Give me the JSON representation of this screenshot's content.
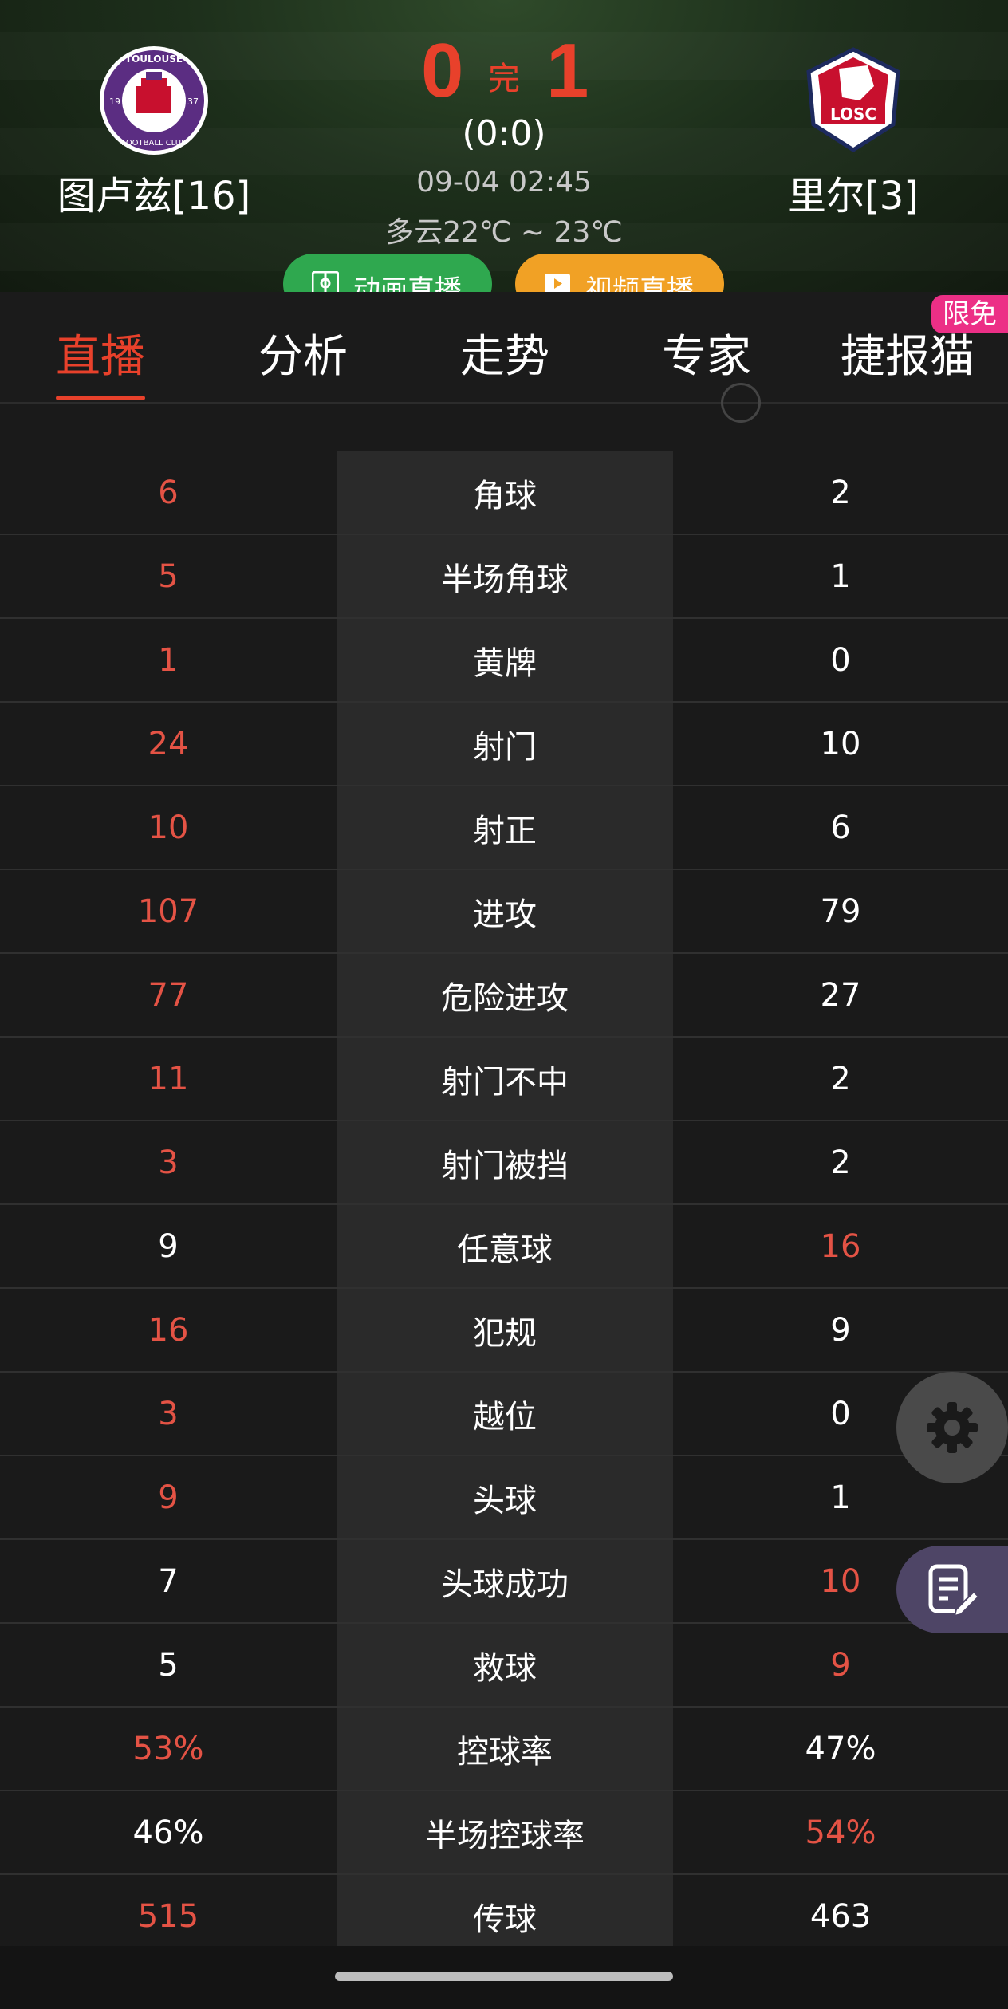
{
  "match": {
    "home_team": "图卢兹[16]",
    "away_team": "里尔[3]",
    "home_score": "0",
    "away_score": "1",
    "status": "完",
    "half_time": "(0:0)",
    "kickoff": "09-04 02:45",
    "weather": "多云22℃ ~ 23℃",
    "home_logo_text": "TOULOUSE FOOTBALL CLUB 19 37",
    "away_logo_text": "LOSC"
  },
  "buttons": {
    "animation": "动画直播",
    "video": "视频直播"
  },
  "tabs": [
    {
      "label": "直播"
    },
    {
      "label": "分析"
    },
    {
      "label": "走势"
    },
    {
      "label": "专家"
    },
    {
      "label": "捷报猫"
    }
  ],
  "badge": "限免",
  "stats": [
    {
      "label": "角球",
      "home": "6",
      "away": "2",
      "leader": "home"
    },
    {
      "label": "半场角球",
      "home": "5",
      "away": "1",
      "leader": "home"
    },
    {
      "label": "黄牌",
      "home": "1",
      "away": "0",
      "leader": "home"
    },
    {
      "label": "射门",
      "home": "24",
      "away": "10",
      "leader": "home"
    },
    {
      "label": "射正",
      "home": "10",
      "away": "6",
      "leader": "home"
    },
    {
      "label": "进攻",
      "home": "107",
      "away": "79",
      "leader": "home"
    },
    {
      "label": "危险进攻",
      "home": "77",
      "away": "27",
      "leader": "home"
    },
    {
      "label": "射门不中",
      "home": "11",
      "away": "2",
      "leader": "home"
    },
    {
      "label": "射门被挡",
      "home": "3",
      "away": "2",
      "leader": "home"
    },
    {
      "label": "任意球",
      "home": "9",
      "away": "16",
      "leader": "away"
    },
    {
      "label": "犯规",
      "home": "16",
      "away": "9",
      "leader": "home"
    },
    {
      "label": "越位",
      "home": "3",
      "away": "0",
      "leader": "home"
    },
    {
      "label": "头球",
      "home": "9",
      "away": "1",
      "leader": "home"
    },
    {
      "label": "头球成功",
      "home": "7",
      "away": "10",
      "leader": "away"
    },
    {
      "label": "救球",
      "home": "5",
      "away": "9",
      "leader": "away"
    },
    {
      "label": "控球率",
      "home": "53%",
      "away": "47%",
      "leader": "home"
    },
    {
      "label": "半场控球率",
      "home": "46%",
      "away": "54%",
      "leader": "away"
    },
    {
      "label": "传球",
      "home": "515",
      "away": "463",
      "leader": "home"
    }
  ],
  "colors": {
    "accent": "#e8412b",
    "stat_red": "#e45345",
    "green_button": "#2fa84f",
    "orange_button": "#f1a125",
    "badge": "#ec2f86"
  }
}
